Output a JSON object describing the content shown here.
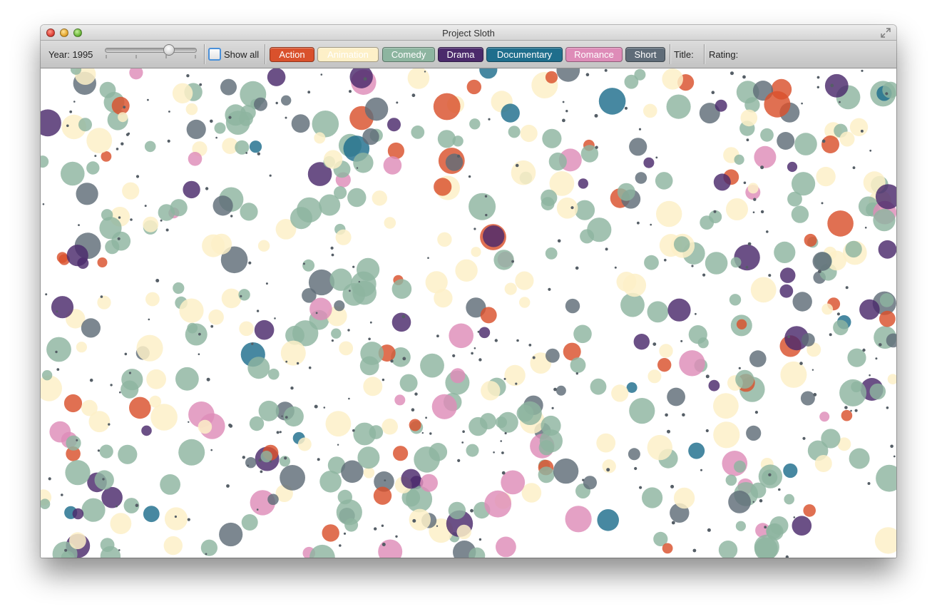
{
  "window": {
    "title": "Project Sloth"
  },
  "toolbar": {
    "year_label": "Year: 1995",
    "year_value": 1995,
    "slider_position": 0.68,
    "show_all_label": "Show all",
    "show_all_checked": false,
    "title_label": "Title:",
    "rating_label": "Rating:"
  },
  "genres": [
    {
      "label": "Action",
      "color": "#d9512c",
      "text_color": "#ffffff"
    },
    {
      "label": "Animation",
      "color": "#fdf0c8",
      "text_color": "#ffffff"
    },
    {
      "label": "Comedy",
      "color": "#8db5a0",
      "text_color": "#ffffff"
    },
    {
      "label": "Drama",
      "color": "#4b2a6b",
      "text_color": "#ffffff"
    },
    {
      "label": "Documentary",
      "color": "#1f6e8c",
      "text_color": "#ffffff"
    },
    {
      "label": "Romance",
      "color": "#de8cb8",
      "text_color": "#ffffff"
    },
    {
      "label": "Short",
      "color": "#5f6c78",
      "text_color": "#ffffff"
    }
  ],
  "canvas": {
    "background": "#ffffff",
    "dot_color": "#555e66"
  }
}
